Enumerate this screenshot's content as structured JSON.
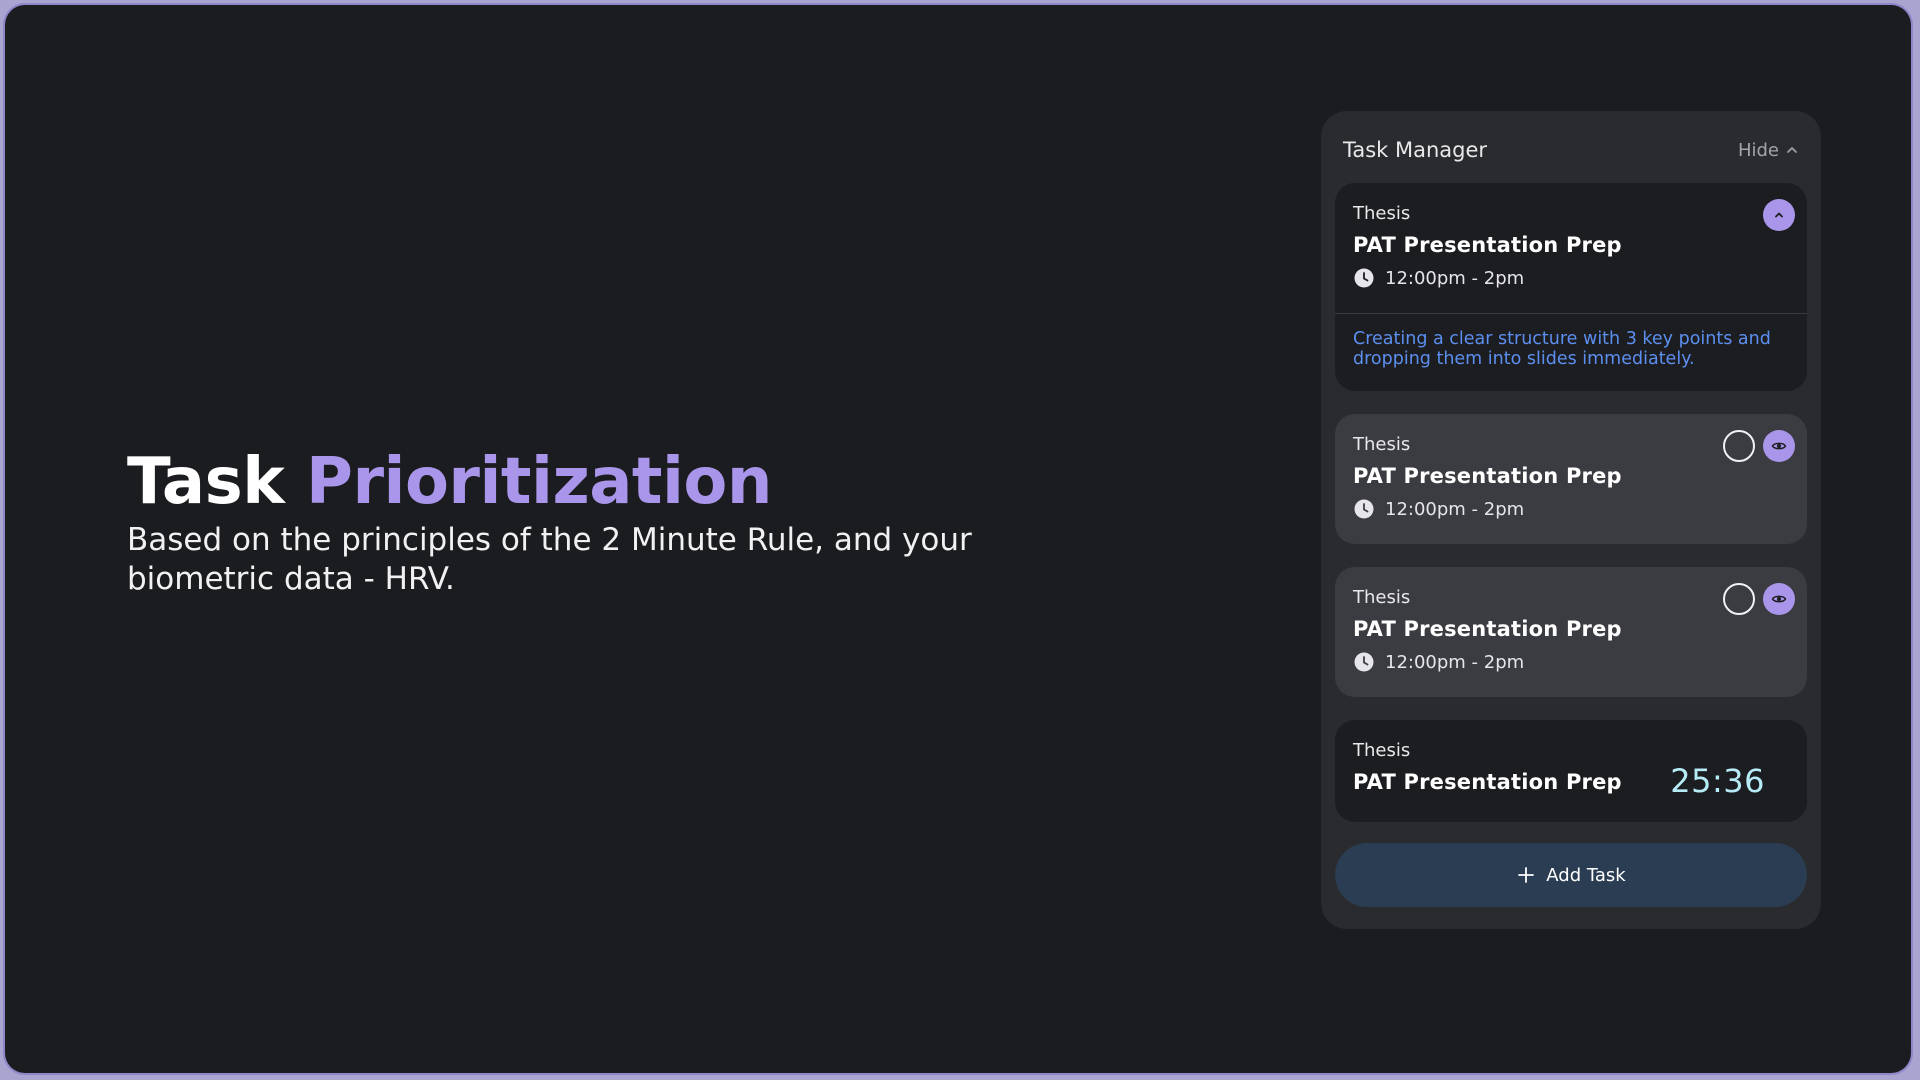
{
  "hero": {
    "title_main": "Task",
    "title_accent": "Prioritization",
    "subtitle": "Based on the principles of the 2 Minute Rule, and your biometric data - HRV."
  },
  "panel": {
    "title": "Task Manager",
    "hide_label": "Hide",
    "hide_icon": "chevron-up-icon"
  },
  "tasks": [
    {
      "category": "Thesis",
      "name": "PAT Presentation Prep",
      "time": "12:00pm - 2pm",
      "note": "Creating a clear structure with 3 key points and dropping them into slides immediately.",
      "state": "expanded",
      "icons": [
        "clock-icon",
        "collapse-chevron-icon"
      ]
    },
    {
      "category": "Thesis",
      "name": "PAT Presentation Prep",
      "time": "12:00pm - 2pm",
      "icons": [
        "clock-icon",
        "complete-circle-icon",
        "eye-icon"
      ]
    },
    {
      "category": "Thesis",
      "name": "PAT Presentation Prep",
      "time": "12:00pm - 2pm",
      "icons": [
        "clock-icon",
        "complete-circle-icon",
        "eye-icon"
      ]
    },
    {
      "category": "Thesis",
      "name": "PAT Presentation Prep",
      "timer": "25:36"
    }
  ],
  "add_task": {
    "label": "Add Task",
    "icon": "plus-icon"
  },
  "colors": {
    "background": "#1b1c1f",
    "panel": "#2a2b2f",
    "accent": "#a996ea",
    "note": "#5c8ff0",
    "timer": "#b6ecf8",
    "add_button": "#2a3d52"
  }
}
